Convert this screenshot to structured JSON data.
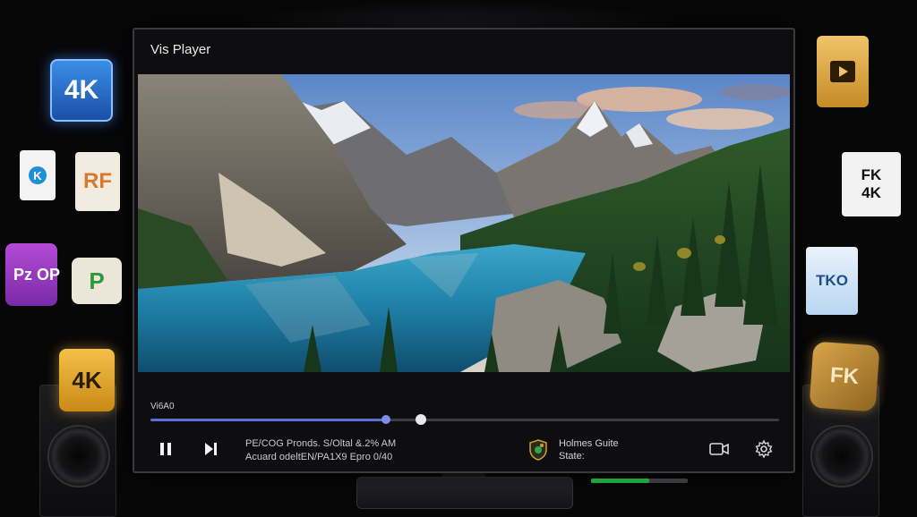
{
  "window": {
    "title": "Vis Player"
  },
  "player": {
    "video_label": "Vi6A0",
    "progress": 0.375,
    "buffered": 0.43,
    "info_line1": "PE/COG Pronds. S/Oltal &.2% AM",
    "info_line2": "Acuard odeltEN/PA1X9 Epro 0/40",
    "status_title": "Holmes Guite",
    "status_label": "State:",
    "status_level": 0.6
  },
  "floating_icons": {
    "left": [
      "4K",
      "RF",
      "Pz OP",
      "P",
      "4K"
    ],
    "right": [
      "FK 4K",
      "TKO",
      "FK"
    ]
  },
  "colors": {
    "accent": "#5b6fd8",
    "status_green": "#1fa53a",
    "background": "#070708"
  }
}
